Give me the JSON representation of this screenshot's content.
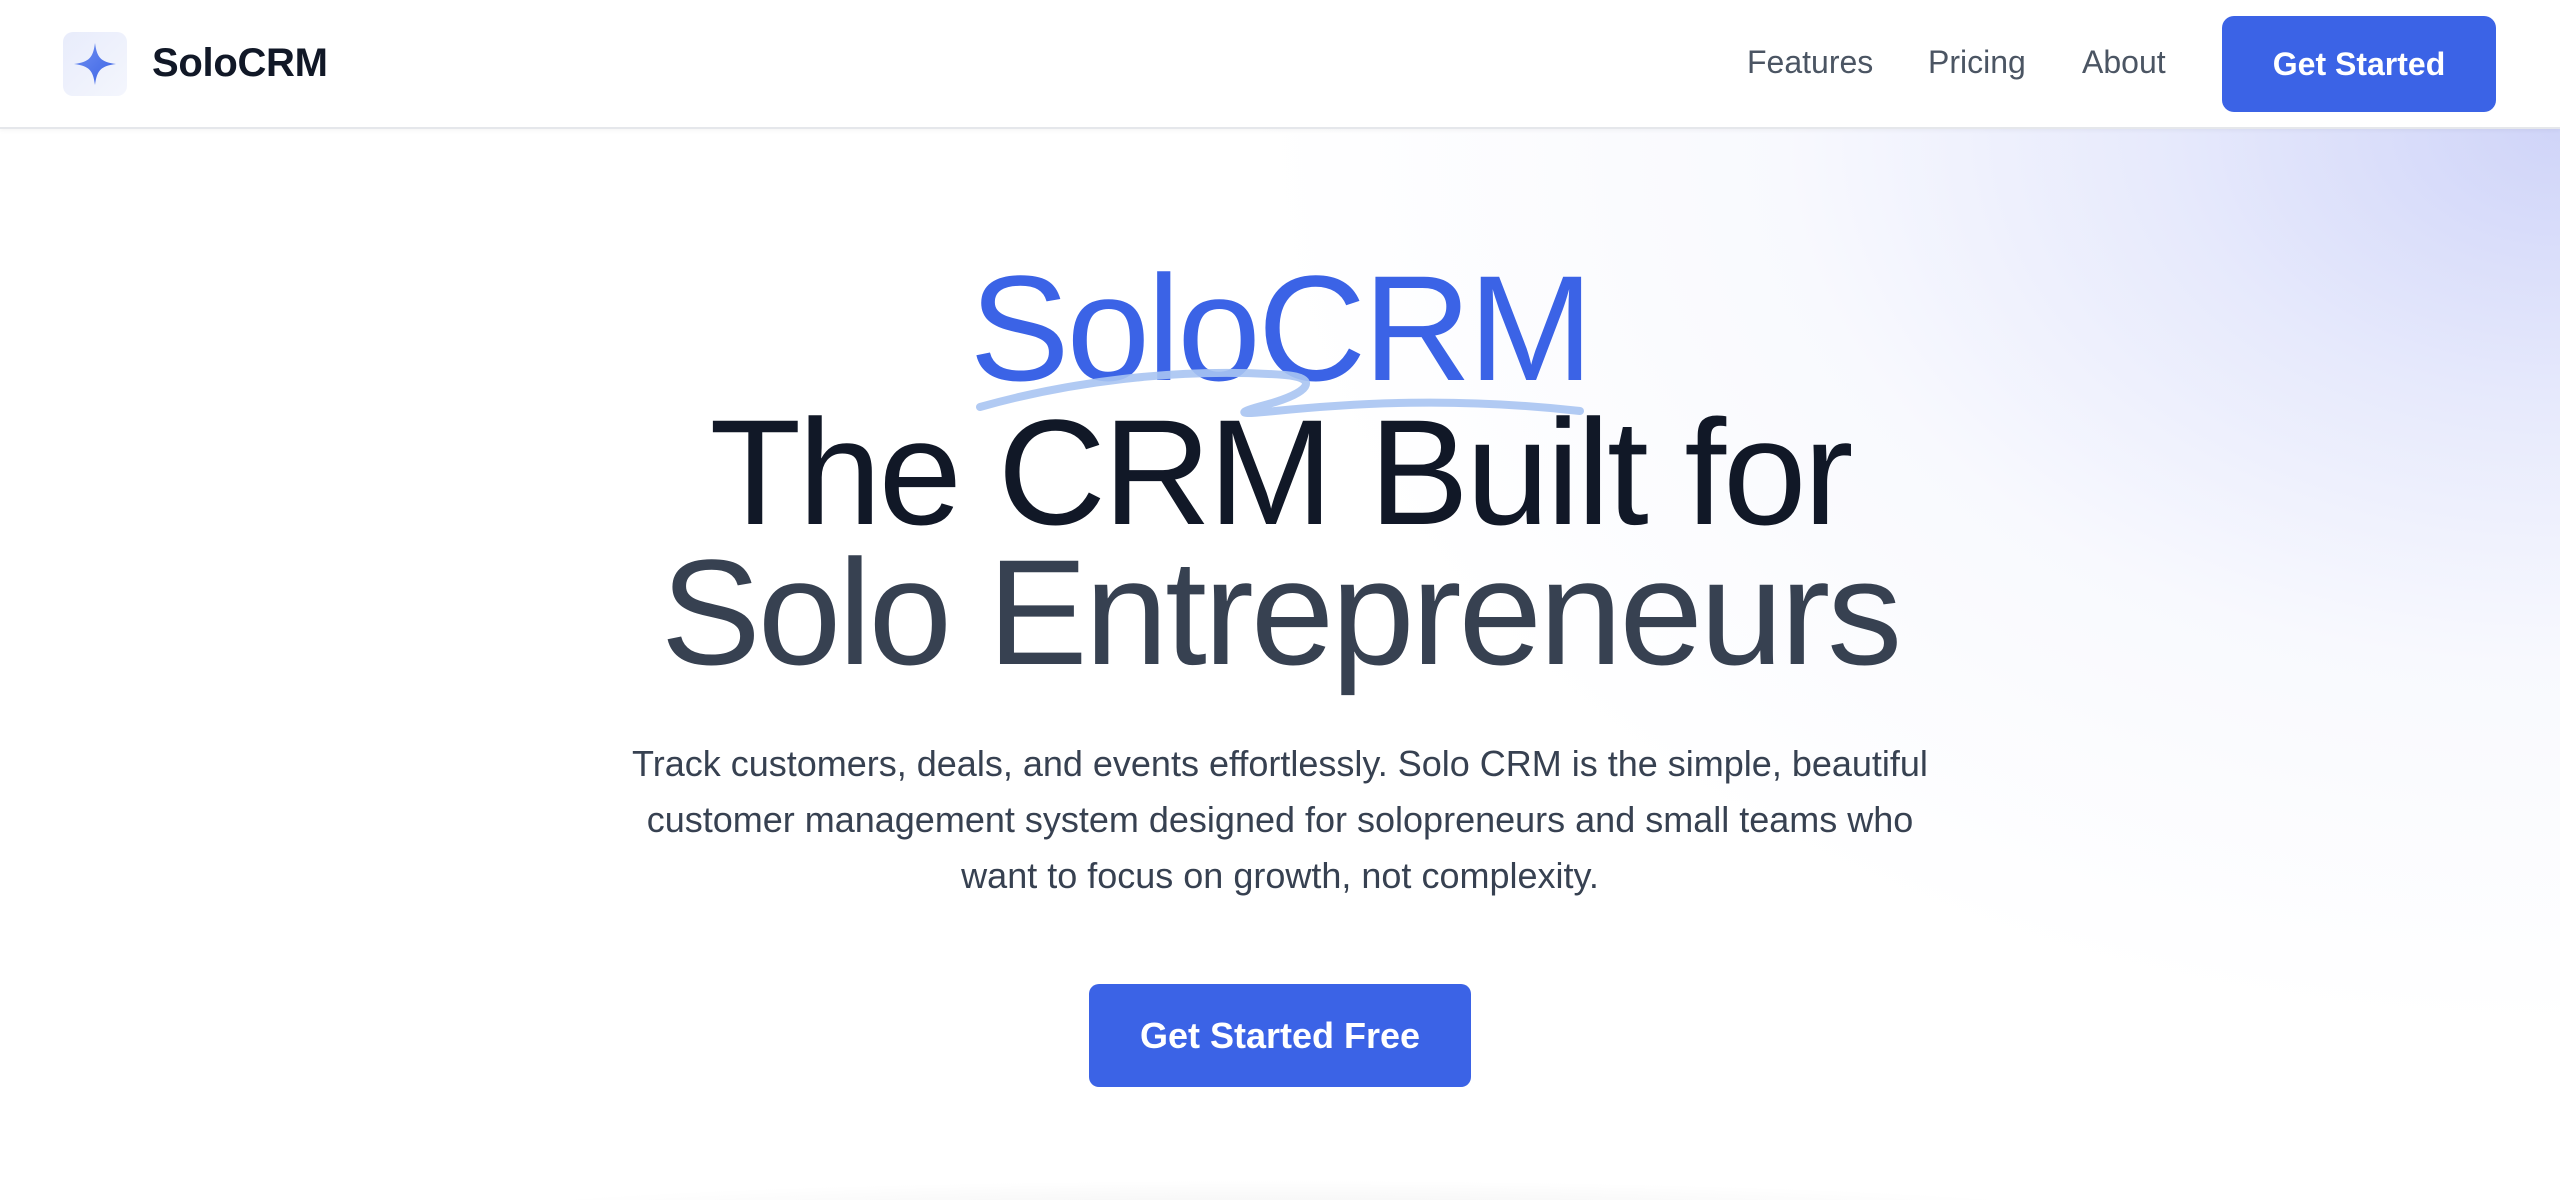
{
  "nav": {
    "brand_name": "SoloCRM",
    "logo_icon": "sparkle-star-icon",
    "links": [
      {
        "label": "Features"
      },
      {
        "label": "Pricing"
      },
      {
        "label": "About"
      }
    ],
    "cta_label": "Get Started"
  },
  "hero": {
    "title_line_1": "SoloCRM",
    "title_line_2": "The CRM Built for",
    "title_line_3": "Solo Entrepreneurs",
    "description": "Track customers, deals, and events effortlessly. Solo CRM is the simple, beautiful customer management system designed for solopreneurs and small teams who want to focus on growth, not complexity.",
    "cta_label": "Get Started Free"
  },
  "colors": {
    "accent": "#3b63e6",
    "heading_dark": "#111827",
    "heading_muted": "#374151",
    "nav_text": "#4b5563",
    "underline": "#a9c4f2"
  }
}
